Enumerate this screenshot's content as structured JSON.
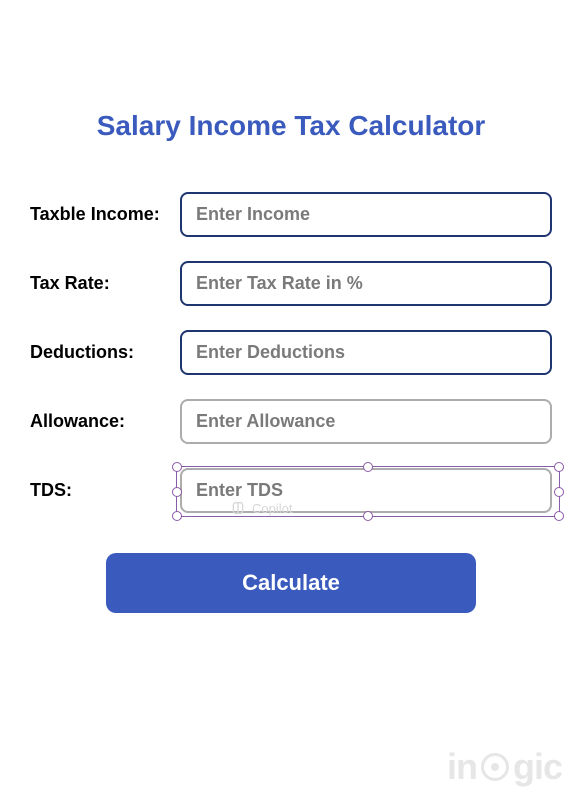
{
  "title": "Salary Income Tax Calculator",
  "form": {
    "taxableIncome": {
      "label": "Taxble Income:",
      "placeholder": "Enter Income",
      "value": ""
    },
    "taxRate": {
      "label": "Tax Rate:",
      "placeholder": "Enter Tax Rate in %",
      "value": ""
    },
    "deductions": {
      "label": "Deductions:",
      "placeholder": "Enter Deductions",
      "value": ""
    },
    "allowance": {
      "label": "Allowance:",
      "placeholder": "Enter Allowance",
      "value": ""
    },
    "tds": {
      "label": "TDS:",
      "placeholder": "Enter TDS",
      "value": ""
    }
  },
  "calculate_label": "Calculate",
  "copilot_hint": "Copilot",
  "watermark_text": "inogic"
}
